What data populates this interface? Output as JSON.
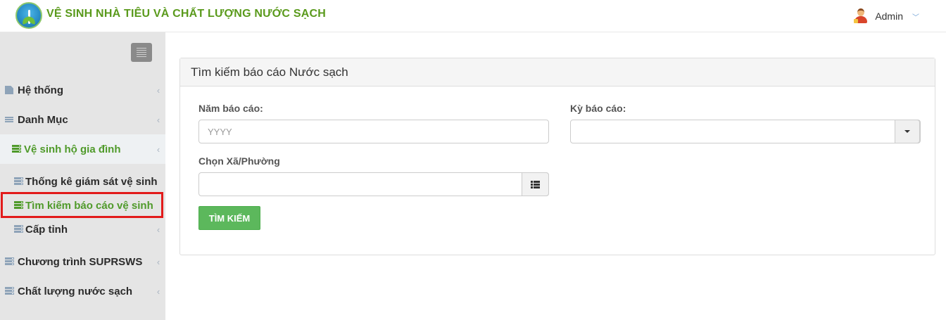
{
  "header": {
    "app_title": "VỆ SINH NHÀ TIÊU VÀ CHẤT LƯỢNG NƯỚC SẠCH",
    "user_name": "Admin",
    "user_caret": "﹀"
  },
  "sidebar": {
    "items": [
      {
        "label": "Hệ thống",
        "icon": "document-icon"
      },
      {
        "label": "Danh Mục",
        "icon": "list-icon"
      },
      {
        "label": "Vệ sinh hộ gia đình",
        "icon": "database-icon"
      },
      {
        "label": "Chương trình SUPRSWS",
        "icon": "database-icon"
      },
      {
        "label": "Chất lượng nước sạch",
        "icon": "database-icon"
      }
    ],
    "subitems": [
      {
        "label": "Thống kê giám sát vệ sinh",
        "icon": "database-icon"
      },
      {
        "label": "Tìm kiếm báo cáo vệ sinh",
        "icon": "database-icon"
      },
      {
        "label": "Cấp tỉnh",
        "icon": "database-icon"
      }
    ],
    "chevron": "‹"
  },
  "panel": {
    "title": "Tìm kiếm báo cáo Nước sạch",
    "year_label": "Năm báo cáo:",
    "year_placeholder": "YYYY",
    "period_label": "Kỳ báo cáo:",
    "period_value": "",
    "commune_label": "Chọn Xã/Phường",
    "commune_value": "",
    "search_button": "TÌM KIẾM"
  },
  "colors": {
    "brand_green": "#5a9a1c",
    "active_green": "#4f9a2a",
    "button_green": "#5cb85c",
    "highlight_red": "#e21b1b",
    "sidebar_bg": "#e5e5e5"
  }
}
